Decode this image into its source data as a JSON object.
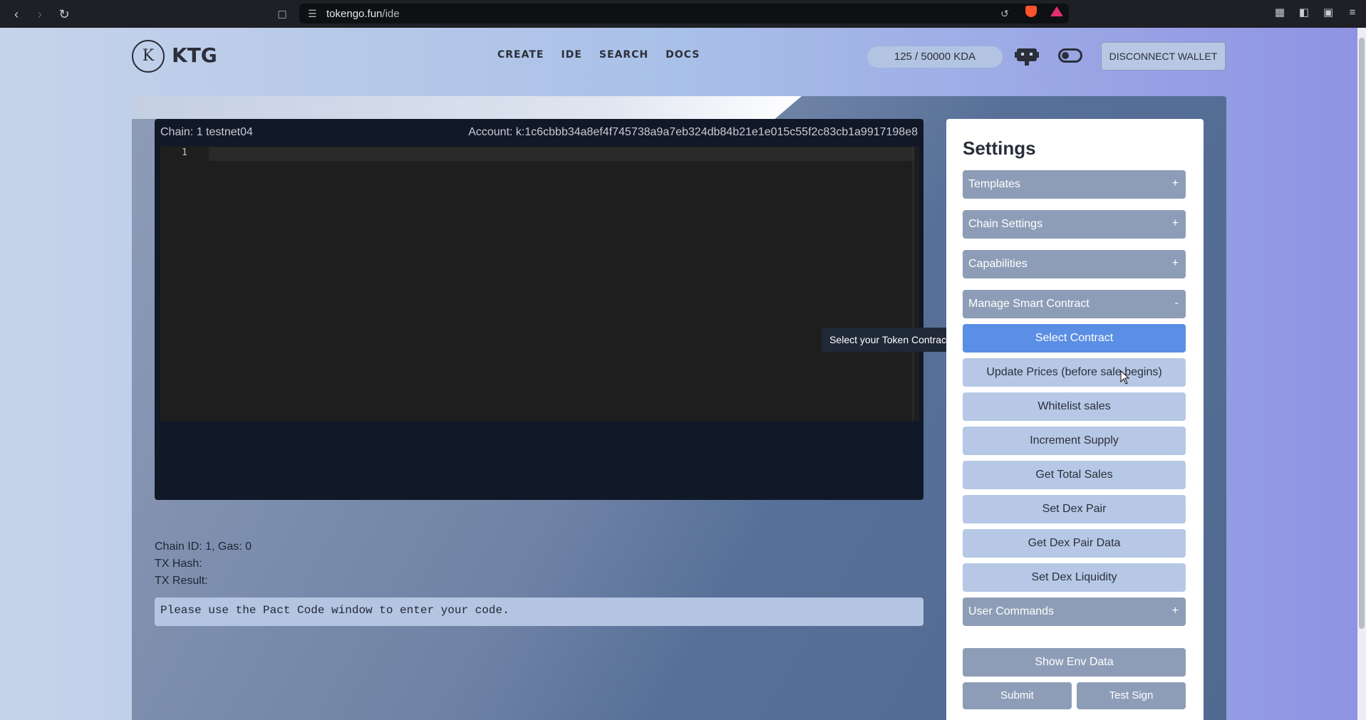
{
  "browser": {
    "url_host": "tokengo.fun",
    "url_path": "/ide"
  },
  "header": {
    "logo_letter": "K",
    "logo_text": "KTG",
    "nav": [
      "CREATE",
      "IDE",
      "SEARCH",
      "DOCS"
    ],
    "balance": "125 / 50000 KDA",
    "wallet_button": "DISCONNECT WALLET"
  },
  "editor": {
    "chain_label": "Chain: 1 testnet04",
    "account_label": "Account: k:1c6cbbb34a8ef4f745738a9a7eb324db84b21e1e015c55f2c83cb1a9917198e8",
    "line_number": "1"
  },
  "tx_info": {
    "chain_gas": "Chain ID: 1, Gas: 0",
    "tx_hash": "TX Hash:",
    "tx_result": "TX Result:"
  },
  "output": {
    "message": "Please use the Pact Code window to enter your code."
  },
  "tooltip": {
    "text": "Select your Token Contract"
  },
  "settings": {
    "title": "Settings",
    "accordions": [
      {
        "label": "Templates",
        "sign": "+"
      },
      {
        "label": "Chain Settings",
        "sign": "+"
      },
      {
        "label": "Capabilities",
        "sign": "+"
      },
      {
        "label": "Manage Smart Contract",
        "sign": "-"
      },
      {
        "label": "User Commands",
        "sign": "+"
      }
    ],
    "contract_actions": [
      "Select Contract",
      "Update Prices (before sale begins)",
      "Whitelist sales",
      "Increment Supply",
      "Get Total Sales",
      "Set Dex Pair",
      "Get Dex Pair Data",
      "Set Dex Liquidity"
    ],
    "show_env": "Show Env Data",
    "submit": "Submit",
    "test_sign": "Test Sign"
  },
  "colors": {
    "primary_button": "#5b8fe5",
    "accordion": "#8e9db7",
    "action_button": "#b6c8e6",
    "editor_bg": "#111827"
  }
}
